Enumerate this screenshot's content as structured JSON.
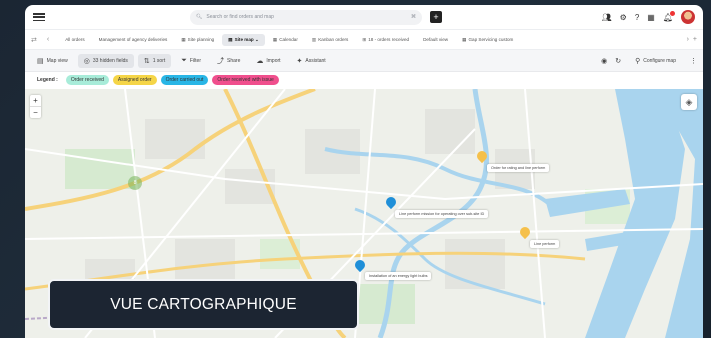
{
  "topbar": {
    "search_placeholder": "Search or find orders and map",
    "search_shortcut": "⌘"
  },
  "tabs": [
    {
      "label": "All orders"
    },
    {
      "label": "Management of agency deliveries"
    },
    {
      "label": "Site planning"
    },
    {
      "label": "Site map",
      "active": true
    },
    {
      "label": "Calendar"
    },
    {
      "label": "Kanban orders"
    },
    {
      "label": "18 - orders received"
    },
    {
      "label": "Default view"
    },
    {
      "label": "Gap Servicing custom"
    }
  ],
  "toolbar": {
    "map_view": "Map view",
    "hidden_fields": "33 hidden fields",
    "sort": "1 sort",
    "filter": "Filter",
    "share": "Share",
    "import": "Import",
    "assistant": "Assistant",
    "configure_map": "Configure map"
  },
  "legend": {
    "title": "Legend :",
    "items": [
      {
        "label": "Order received",
        "color": "#a8ecd9"
      },
      {
        "label": "Assigned order",
        "color": "#f5d547"
      },
      {
        "label": "Order carried out",
        "color": "#29b6e6"
      },
      {
        "label": "Order received with issue",
        "color": "#f04f8d"
      }
    ]
  },
  "map": {
    "zoom_in": "+",
    "zoom_out": "−",
    "cluster_count": "8",
    "popups": [
      "Order for rating and line perform",
      "Line perform mission for operating over sub-site ID",
      "Line perform",
      "Installation of an energy light bulbs"
    ]
  },
  "caption": {
    "label": "VUE CARTOGRAPHIQUE"
  }
}
